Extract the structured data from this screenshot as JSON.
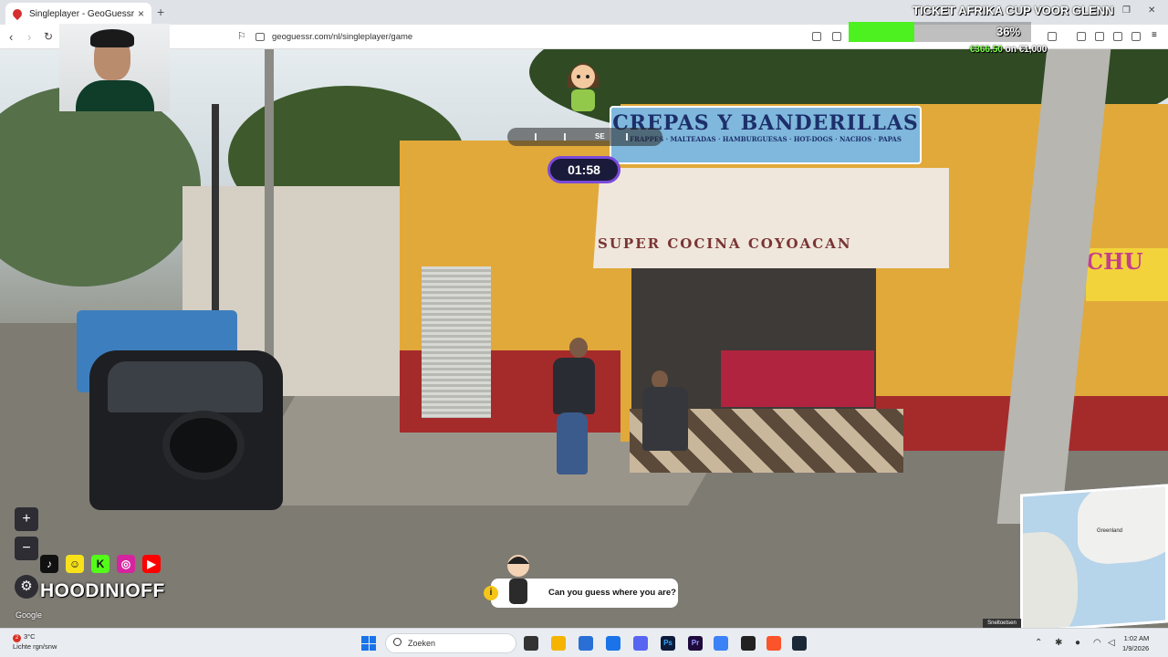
{
  "browser": {
    "tab_title": "Singleplayer - GeoGuessr",
    "new_tab": "+",
    "url": "geoguessr.com/nl/singleplayer/game",
    "window_controls": [
      "—",
      "❐",
      "✕"
    ]
  },
  "donation_goal": {
    "title": "TICKET AFRIKA CUP VOOR GLENN",
    "percent_label": "36%",
    "progress": 0.36,
    "raised": "€366.50",
    "target_text": "on €1,000",
    "fill_color": "#4cf11f"
  },
  "game": {
    "compass_direction": "SE",
    "timer": "01:58",
    "zoom_in": "+",
    "zoom_out": "−",
    "settings_icon": "gear-icon",
    "hint_text": "Can you guess where you are?",
    "hint_icon": "i",
    "map_label": "Greenland",
    "shortcut_label": "Sneltoetsen",
    "attribution": "Google",
    "accent_color": "#7a4ad9"
  },
  "scene": {
    "sign_main": "CREPAS Y BANDERILLAS",
    "sign_sub": "FRAPPES · MALTEADAS · HAMBURGUESAS · HOT-DOGS · NACHOS · PAPAS",
    "awning_text": "SUPER  COCINA  COYOACAN",
    "side_banner": "CHU"
  },
  "streamer": {
    "name": "HOODINIOFF",
    "socials": [
      {
        "name": "tiktok-icon",
        "glyph": "♪",
        "color": "#111111"
      },
      {
        "name": "snapchat-icon",
        "glyph": "☺",
        "color": "#f7e11b"
      },
      {
        "name": "kick-icon",
        "glyph": "K",
        "color": "#53fc18"
      },
      {
        "name": "instagram-icon",
        "glyph": "◎",
        "color": "#d6249f"
      },
      {
        "name": "youtube-icon",
        "glyph": "▶",
        "color": "#ff0000"
      }
    ]
  },
  "taskbar": {
    "weather_temp": "3°C",
    "weather_desc": "Lichte rgn/snw",
    "weather_badge": "2",
    "search_placeholder": "Zoeken",
    "time": "1:02 AM",
    "date": "1/9/2026"
  }
}
